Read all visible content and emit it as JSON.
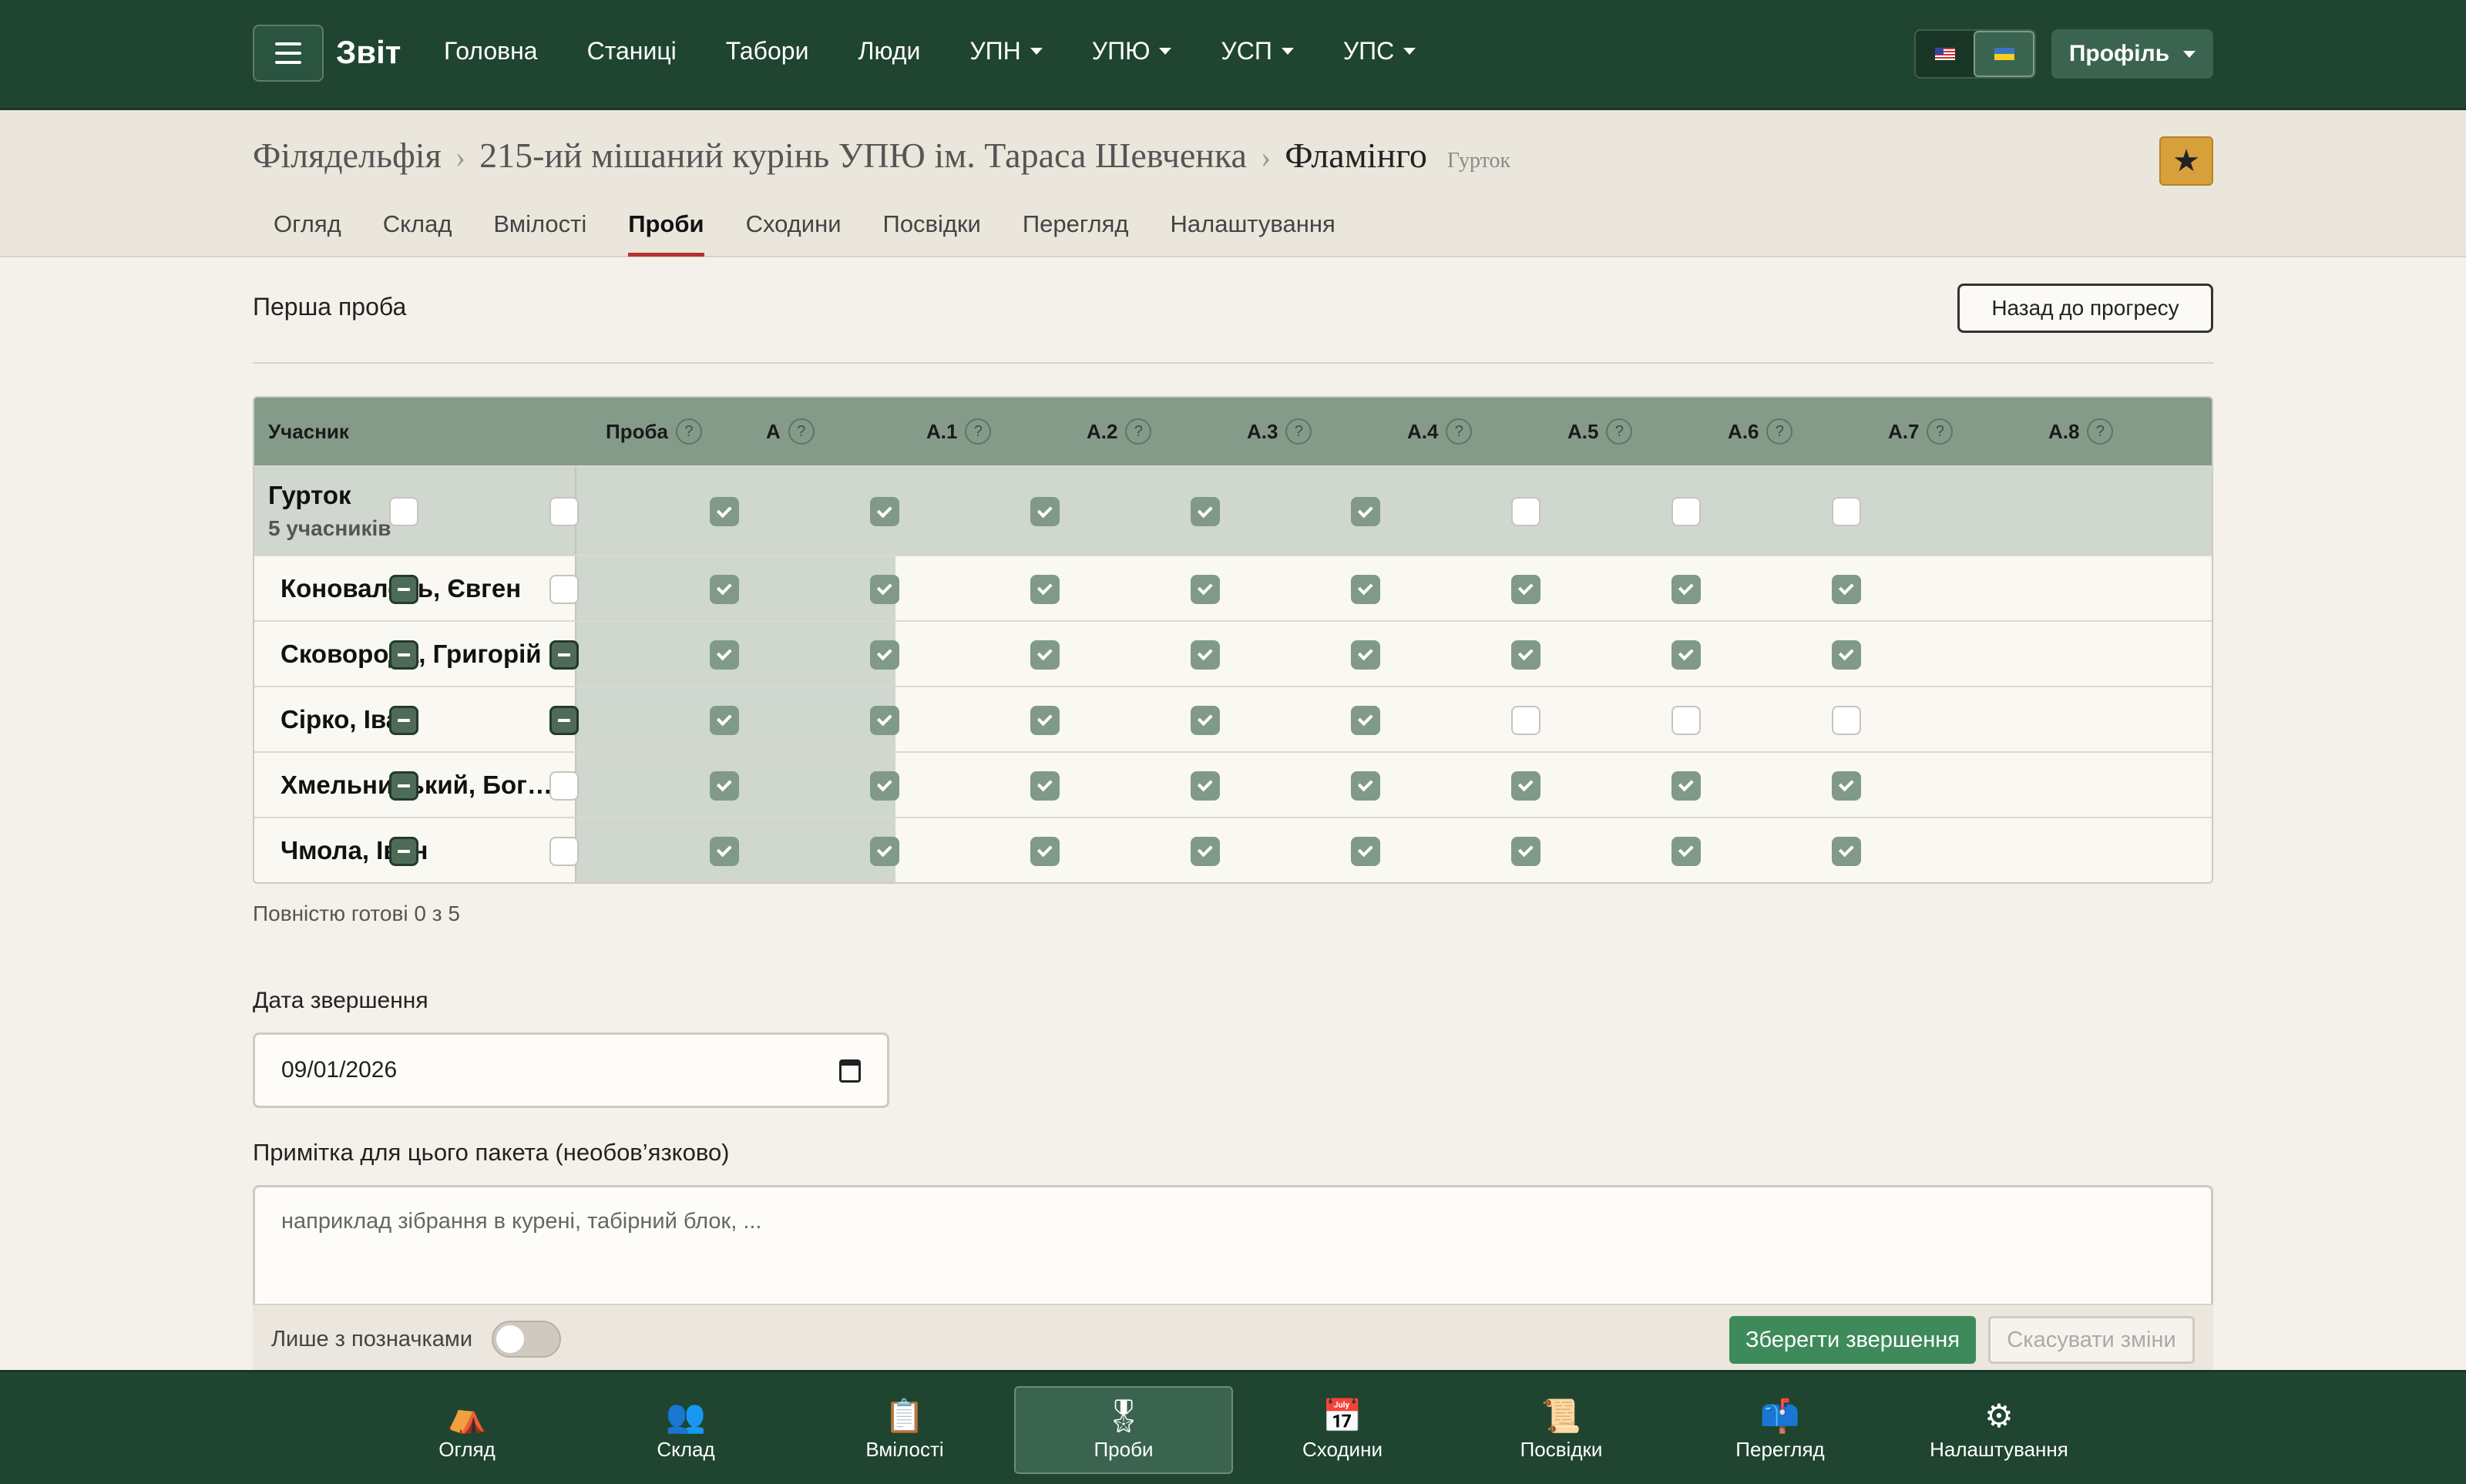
{
  "app": {
    "brand": "Звіт"
  },
  "topnav": {
    "links": [
      {
        "label": "Головна",
        "dropdown": false
      },
      {
        "label": "Станиці",
        "dropdown": false
      },
      {
        "label": "Табори",
        "dropdown": false
      },
      {
        "label": "Люди",
        "dropdown": false
      },
      {
        "label": "УПН",
        "dropdown": true
      },
      {
        "label": "УПЮ",
        "dropdown": true
      },
      {
        "label": "УСП",
        "dropdown": true
      },
      {
        "label": "УПС",
        "dropdown": true
      }
    ],
    "languages": [
      "us-flag-icon",
      "ua-flag-icon"
    ],
    "active_language": "ua",
    "profile_label": "Профіль"
  },
  "breadcrumb": {
    "items": [
      "Філядельфія",
      "215-ий мішаний курінь УПЮ ім. Тараса Шевченка",
      "Фламінго"
    ],
    "type_label": "Гурток"
  },
  "tabs": [
    "Огляд",
    "Склад",
    "Вмілості",
    "Проби",
    "Сходини",
    "Посвідки",
    "Перегляд",
    "Налаштування"
  ],
  "active_tab": "Проби",
  "section": {
    "title": "Перша проба",
    "back_label": "Назад до прогресу"
  },
  "table": {
    "name_header": "Учасник",
    "columns": [
      "Проба",
      "А",
      "А.1",
      "А.2",
      "А.3",
      "А.4",
      "А.5",
      "А.6",
      "А.7",
      "А.8"
    ],
    "group": {
      "name": "Гурток",
      "sub": "5 учасників",
      "states": [
        "off",
        "off",
        "on",
        "on",
        "on",
        "on",
        "on",
        "off",
        "off",
        "off"
      ]
    },
    "rows": [
      {
        "name": "Коновалець, Євген",
        "states": [
          "ind",
          "off",
          "on",
          "on",
          "on",
          "on",
          "on",
          "on",
          "on",
          "on"
        ]
      },
      {
        "name": "Сковорода, Григорій",
        "states": [
          "ind",
          "ind",
          "on",
          "on",
          "on",
          "on",
          "on",
          "on",
          "on",
          "on"
        ]
      },
      {
        "name": "Сірко, Іван",
        "states": [
          "ind",
          "ind",
          "on",
          "on",
          "on",
          "on",
          "on",
          "off",
          "off",
          "off"
        ]
      },
      {
        "name": "Хмельницький, Бог…",
        "states": [
          "ind",
          "off",
          "on",
          "on",
          "on",
          "on",
          "on",
          "on",
          "on",
          "on"
        ]
      },
      {
        "name": "Чмола, Іван",
        "states": [
          "ind",
          "off",
          "on",
          "on",
          "on",
          "on",
          "on",
          "on",
          "on",
          "on"
        ]
      }
    ]
  },
  "ready_text": "Повністю готові 0 з 5",
  "date": {
    "label": "Дата звершення",
    "value": "09/01/2026"
  },
  "note": {
    "label": "Примітка для цього пакета (необов’язково)",
    "placeholder": "наприклад зібрання в курені, табірний блок, ..."
  },
  "savebar": {
    "toggle_label": "Лише з позначками",
    "save_label": "Зберегти звершення",
    "cancel_label": "Скасувати зміни"
  },
  "bottomnav": [
    {
      "label": "Огляд",
      "icon": "campfire-icon",
      "glyph": "⛺"
    },
    {
      "label": "Склад",
      "icon": "people-icon",
      "glyph": "👥"
    },
    {
      "label": "Вмілості",
      "icon": "clipboard-icon",
      "glyph": "📋"
    },
    {
      "label": "Проби",
      "icon": "medal-icon",
      "glyph": "🎖"
    },
    {
      "label": "Сходини",
      "icon": "calendar-icon",
      "glyph": "📅"
    },
    {
      "label": "Посвідки",
      "icon": "scroll-icon",
      "glyph": "📜"
    },
    {
      "label": "Перегляд",
      "icon": "mailbox-icon",
      "glyph": "📫"
    },
    {
      "label": "Налаштування",
      "icon": "gear-icon",
      "glyph": "⚙"
    }
  ],
  "colors": {
    "nav": "#1f4430",
    "accent_green": "#3f8a5a",
    "tab_underline": "#b83030",
    "star": "#d8a03a"
  }
}
